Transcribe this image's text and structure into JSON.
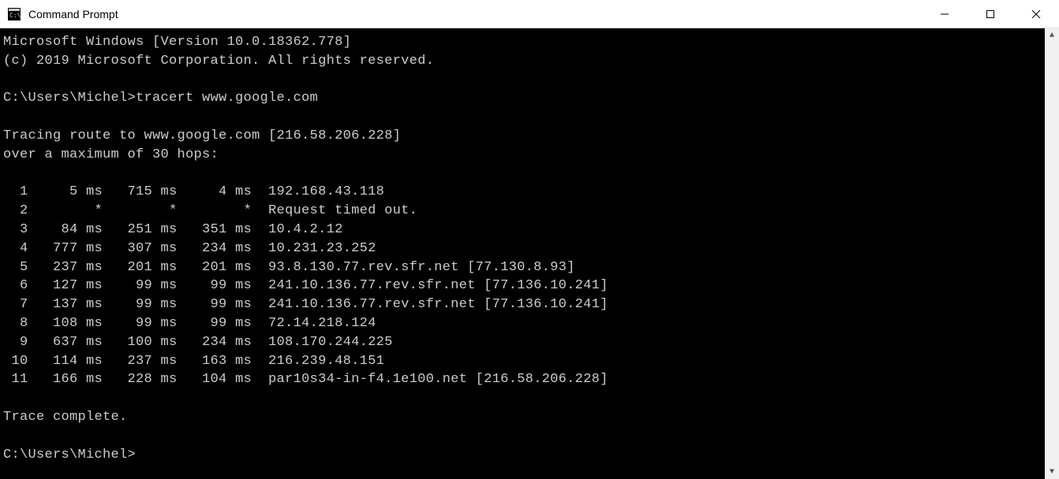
{
  "window": {
    "title": "Command Prompt"
  },
  "header": {
    "version": "Microsoft Windows [Version 10.0.18362.778]",
    "copyright": "(c) 2019 Microsoft Corporation. All rights reserved."
  },
  "prompt": {
    "path": "C:\\Users\\Michel>",
    "command": "tracert www.google.com"
  },
  "trace": {
    "intro1": "Tracing route to www.google.com [216.58.206.228]",
    "intro2": "over a maximum of 30 hops:",
    "hops": [
      {
        "n": "1",
        "t1": "5 ms",
        "t2": "715 ms",
        "t3": "4 ms",
        "host": "192.168.43.118"
      },
      {
        "n": "2",
        "t1": "*",
        "t2": "*",
        "t3": "*",
        "host": "Request timed out."
      },
      {
        "n": "3",
        "t1": "84 ms",
        "t2": "251 ms",
        "t3": "351 ms",
        "host": "10.4.2.12"
      },
      {
        "n": "4",
        "t1": "777 ms",
        "t2": "307 ms",
        "t3": "234 ms",
        "host": "10.231.23.252"
      },
      {
        "n": "5",
        "t1": "237 ms",
        "t2": "201 ms",
        "t3": "201 ms",
        "host": "93.8.130.77.rev.sfr.net [77.130.8.93]"
      },
      {
        "n": "6",
        "t1": "127 ms",
        "t2": "99 ms",
        "t3": "99 ms",
        "host": "241.10.136.77.rev.sfr.net [77.136.10.241]"
      },
      {
        "n": "7",
        "t1": "137 ms",
        "t2": "99 ms",
        "t3": "99 ms",
        "host": "241.10.136.77.rev.sfr.net [77.136.10.241]"
      },
      {
        "n": "8",
        "t1": "108 ms",
        "t2": "99 ms",
        "t3": "99 ms",
        "host": "72.14.218.124"
      },
      {
        "n": "9",
        "t1": "637 ms",
        "t2": "100 ms",
        "t3": "234 ms",
        "host": "108.170.244.225"
      },
      {
        "n": "10",
        "t1": "114 ms",
        "t2": "237 ms",
        "t3": "163 ms",
        "host": "216.239.48.151"
      },
      {
        "n": "11",
        "t1": "166 ms",
        "t2": "228 ms",
        "t3": "104 ms",
        "host": "par10s34-in-f4.1e100.net [216.58.206.228]"
      }
    ],
    "complete": "Trace complete."
  },
  "prompt2": {
    "path": "C:\\Users\\Michel>"
  }
}
